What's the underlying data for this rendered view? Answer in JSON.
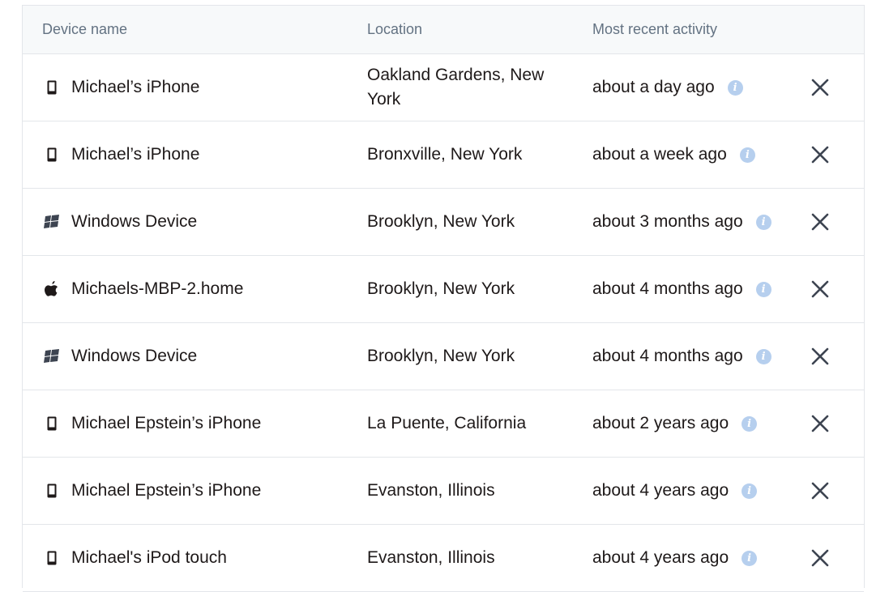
{
  "table": {
    "headers": {
      "device_name": "Device name",
      "location": "Location",
      "activity": "Most recent activity"
    },
    "rows": [
      {
        "icon": "phone-icon",
        "name": "Michael’s iPhone",
        "location": "Oakland Gardens, New York",
        "activity": "about a day ago"
      },
      {
        "icon": "phone-icon",
        "name": "Michael’s iPhone",
        "location": "Bronxville, New York",
        "activity": "about a week ago"
      },
      {
        "icon": "windows-icon",
        "name": "Windows Device",
        "location": "Brooklyn, New York",
        "activity": "about 3 months ago"
      },
      {
        "icon": "apple-icon",
        "name": "Michaels-MBP-2.home",
        "location": "Brooklyn, New York",
        "activity": "about 4 months ago"
      },
      {
        "icon": "windows-icon",
        "name": "Windows Device",
        "location": "Brooklyn, New York",
        "activity": "about 4 months ago"
      },
      {
        "icon": "phone-icon",
        "name": "Michael Epstein’s iPhone",
        "location": "La Puente, California",
        "activity": "about 2 years ago"
      },
      {
        "icon": "phone-icon",
        "name": "Michael Epstein’s iPhone",
        "location": "Evanston, Illinois",
        "activity": "about 4 years ago"
      },
      {
        "icon": "phone-icon",
        "name": "Michael's iPod touch",
        "location": "Evanston, Illinois",
        "activity": "about 4 years ago"
      }
    ]
  },
  "icons": {
    "info": "info-icon",
    "remove": "close-icon"
  },
  "colors": {
    "info_icon": "#b6cfee",
    "header_bg": "#f7f9fa",
    "text": "#1e1919",
    "muted": "#637282"
  }
}
